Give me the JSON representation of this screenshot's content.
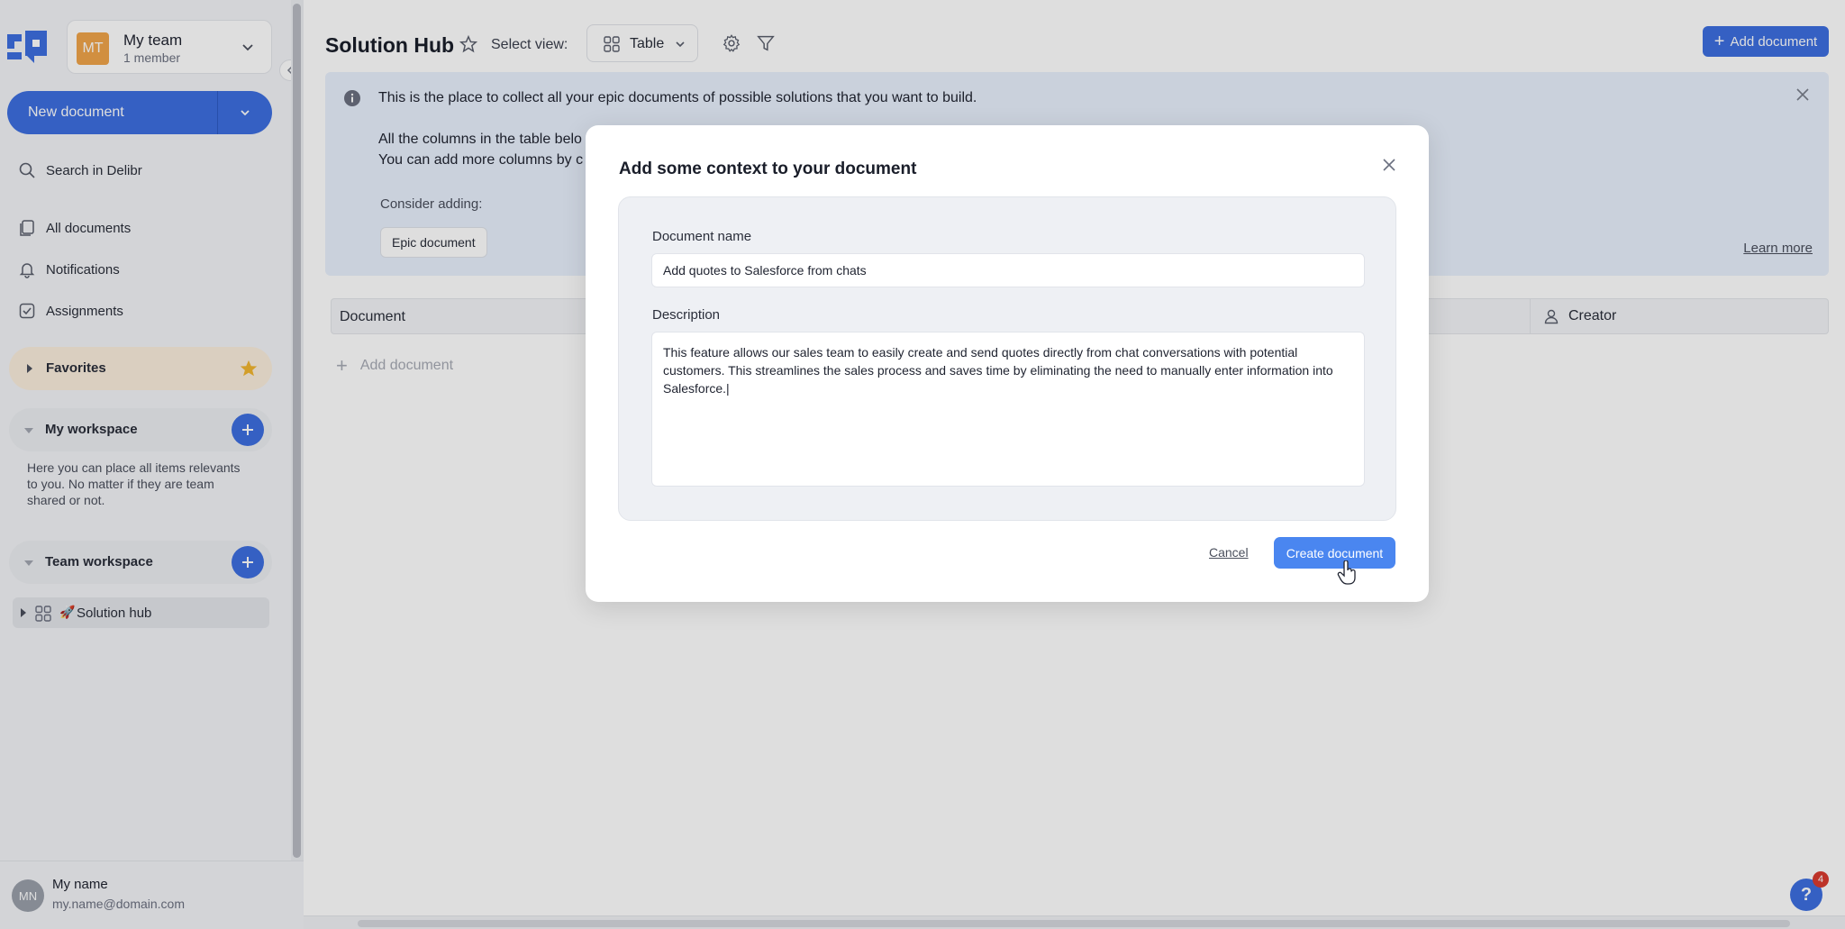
{
  "sidebar": {
    "team": {
      "initials": "MT",
      "name": "My team",
      "meta": "1 member"
    },
    "new_document": "New document",
    "search": "Search in Delibr",
    "nav": [
      {
        "label": "All documents"
      },
      {
        "label": "Notifications"
      },
      {
        "label": "Assignments"
      }
    ],
    "favorites": "Favorites",
    "my_workspace": "My workspace",
    "my_workspace_help": "Here you can place all items relevants to you. No matter if they are team shared or not.",
    "team_workspace": "Team workspace",
    "tree_item": {
      "emoji": "🚀",
      "label": "Solution hub"
    },
    "user": {
      "initials": "MN",
      "name": "My name",
      "email": "my.name@domain.com"
    }
  },
  "header": {
    "title": "Solution Hub",
    "select_view_label": "Select view:",
    "view_value": "Table",
    "add_document": "Add document"
  },
  "banner": {
    "line1": "This is the place to collect all your epic documents of possible solutions that you want to build.",
    "line2": "All the columns in the table belo",
    "line3": "You can add more columns by c",
    "consider": "Consider adding:",
    "chip": "Epic document",
    "learn_more": "Learn more"
  },
  "table": {
    "col_document": "Document",
    "col_creator": "Creator",
    "add_row": "Add document"
  },
  "help": {
    "glyph": "?",
    "badge": "4"
  },
  "modal": {
    "title": "Add some context to your document",
    "name_label": "Document name",
    "name_value": "Add quotes to Salesforce from chats",
    "description_label": "Description",
    "description_value": "This feature allows our sales team to easily create and send quotes directly from chat conversations with potential customers. This streamlines the sales process and saves time by eliminating the need to manually enter information into Salesforce.|",
    "cancel": "Cancel",
    "create": "Create document"
  },
  "colors": {
    "accent": "#3d6fe0",
    "create_button": "#4a86f0",
    "team_avatar": "#f0a54a",
    "favorites_bg": "#fbeedd",
    "banner_bg": "#e8f0fd",
    "badge": "#d93b30"
  }
}
